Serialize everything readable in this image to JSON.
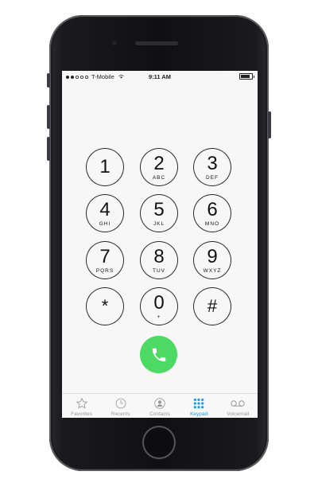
{
  "status_bar": {
    "carrier": "T-Mobile",
    "time": "9:11 AM",
    "signal_bars": 5,
    "signal_filled": 2
  },
  "keypad": {
    "keys": [
      {
        "digit": "1",
        "letters": ""
      },
      {
        "digit": "2",
        "letters": "ABC"
      },
      {
        "digit": "3",
        "letters": "DEF"
      },
      {
        "digit": "4",
        "letters": "GHI"
      },
      {
        "digit": "5",
        "letters": "JKL"
      },
      {
        "digit": "6",
        "letters": "MNO"
      },
      {
        "digit": "7",
        "letters": "PQRS"
      },
      {
        "digit": "8",
        "letters": "TUV"
      },
      {
        "digit": "9",
        "letters": "WXYZ"
      },
      {
        "digit": "*",
        "letters": ""
      },
      {
        "digit": "0",
        "letters": "+"
      },
      {
        "digit": "#",
        "letters": ""
      }
    ],
    "call_icon": "phone-handset-icon",
    "call_color": "#4cd964"
  },
  "tab_bar": {
    "active_color": "#1a9bf0",
    "inactive_color": "#9a9a9a",
    "tabs": [
      {
        "label": "Favorites",
        "icon": "star-icon",
        "active": false
      },
      {
        "label": "Recents",
        "icon": "clock-icon",
        "active": false
      },
      {
        "label": "Contacts",
        "icon": "person-icon",
        "active": false
      },
      {
        "label": "Keypad",
        "icon": "keypad-grid-icon",
        "active": true
      },
      {
        "label": "Voicemail",
        "icon": "voicemail-icon",
        "active": false
      }
    ]
  }
}
